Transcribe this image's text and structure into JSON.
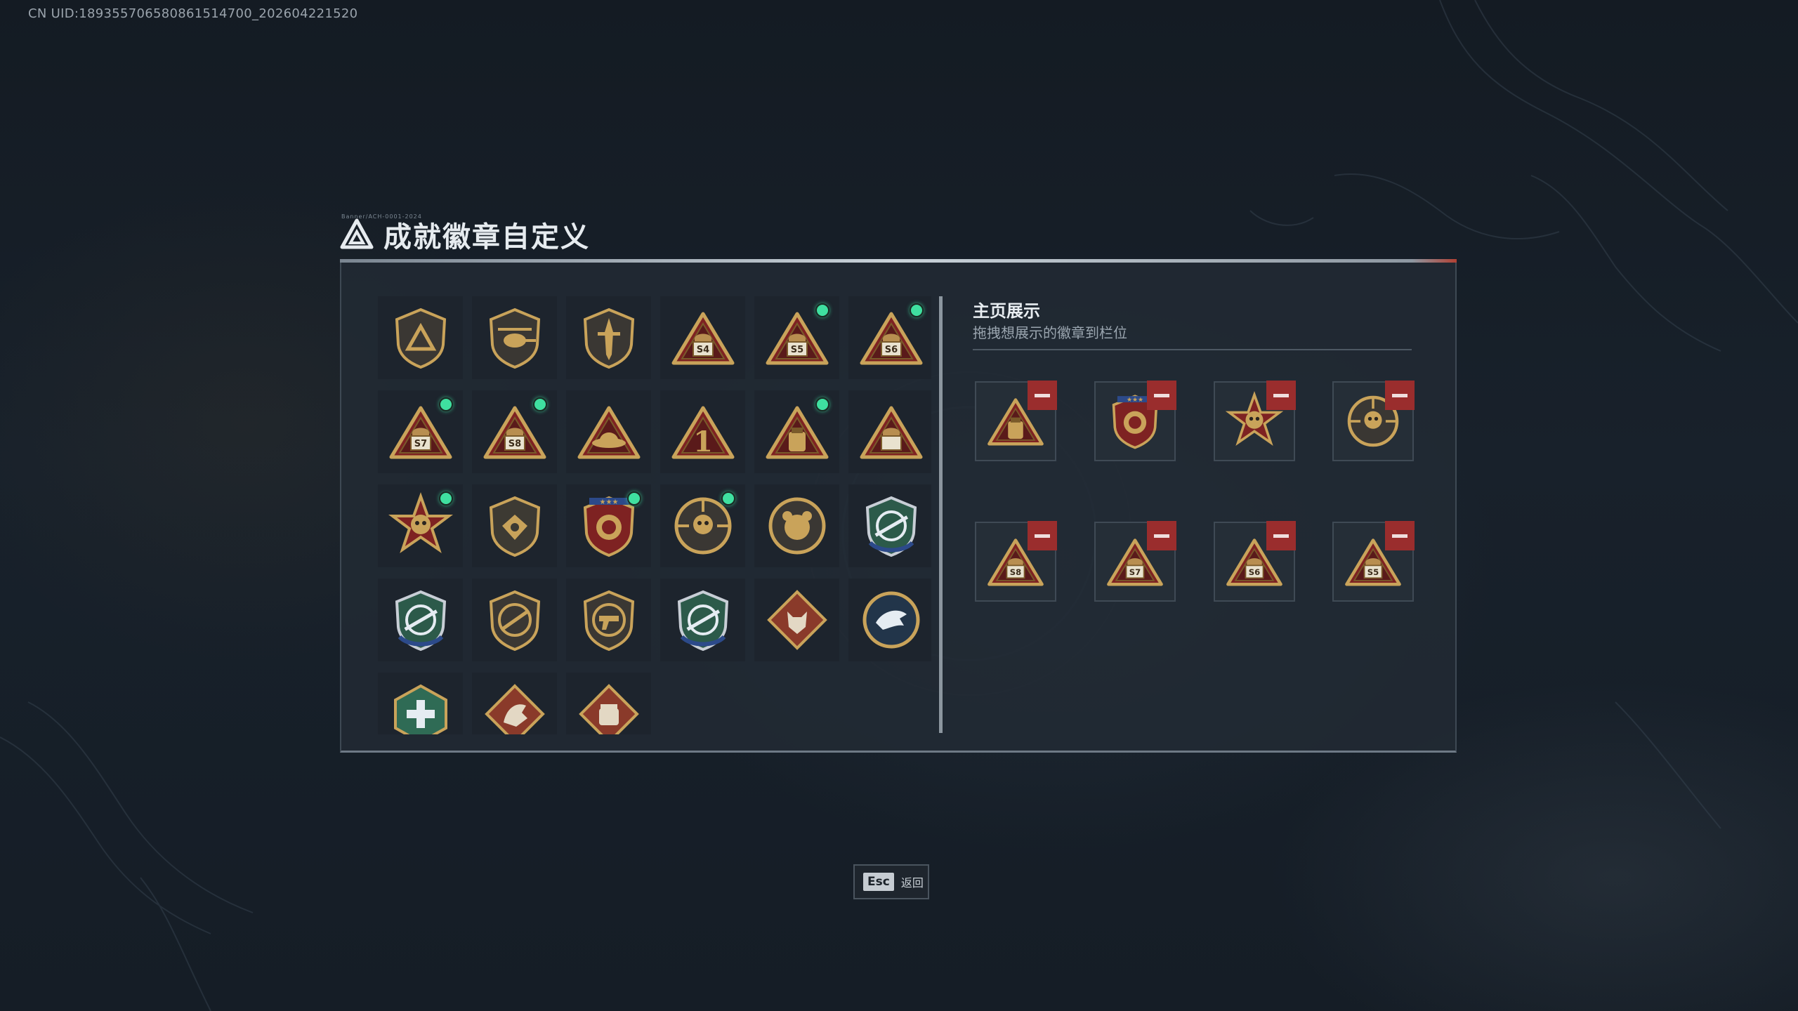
{
  "uid_text": "CN UID:189355706580861514700_202604221520",
  "header": {
    "title": "成就徽章自定义",
    "tiny_text": "Banner/ACH-0001-2024"
  },
  "showcase": {
    "title": "主页展示",
    "subtitle": "拖拽想展示的徽章到栏位"
  },
  "footer": {
    "esc_key": "Esc",
    "esc_label": "返回"
  },
  "colors": {
    "accent_new": "#3fe0a0",
    "remove_red": "#9a2d2d",
    "badge_gold": "#c9a35a",
    "panel_bg": "#222b35"
  },
  "badges": [
    {
      "id": "delta-shield-badge",
      "new": false
    },
    {
      "id": "helicopter-shield-badge",
      "new": false
    },
    {
      "id": "dagger-shield-badge",
      "new": false
    },
    {
      "id": "s4-pyramid-badge",
      "label": "S4",
      "new": false
    },
    {
      "id": "s5-pyramid-badge",
      "label": "S5",
      "new": true
    },
    {
      "id": "s6-pyramid-badge",
      "label": "S6",
      "new": true
    },
    {
      "id": "s7-pyramid-badge",
      "label": "S7",
      "new": true
    },
    {
      "id": "s8-pyramid-badge",
      "label": "S8",
      "new": true
    },
    {
      "id": "hat-pyramid-badge",
      "new": false
    },
    {
      "id": "rank-one-pyramid-badge",
      "label": "1",
      "new": false
    },
    {
      "id": "backpack-pyramid-badge",
      "new": true
    },
    {
      "id": "soldier-pyramid-badge",
      "new": false
    },
    {
      "id": "star-skull-medal-badge",
      "new": true
    },
    {
      "id": "wings-shield-badge",
      "new": false
    },
    {
      "id": "red-crest-medal-badge",
      "new": true
    },
    {
      "id": "skull-crosshair-badge",
      "new": true
    },
    {
      "id": "bear-round-badge",
      "new": false
    },
    {
      "id": "blue-sniper-shield-badge",
      "new": false
    },
    {
      "id": "blue-rifle-shield-badge",
      "new": false
    },
    {
      "id": "rifle-shield-badge",
      "new": false
    },
    {
      "id": "pistol-shield-badge",
      "new": false
    },
    {
      "id": "blue-crosshair-shield-badge",
      "new": false
    },
    {
      "id": "wolf-diamond-badge",
      "new": false
    },
    {
      "id": "eagle-round-badge",
      "new": false
    },
    {
      "id": "medic-hex-badge",
      "new": false
    },
    {
      "id": "dragon-diamond-badge",
      "new": false
    },
    {
      "id": "fist-diamond-badge",
      "new": false
    }
  ],
  "display_slots": [
    {
      "id": "backpack-pyramid-badge"
    },
    {
      "id": "red-crest-medal-badge"
    },
    {
      "id": "star-skull-medal-badge"
    },
    {
      "id": "skull-crosshair-badge"
    },
    {
      "id": "s8-pyramid-badge",
      "label": "S8"
    },
    {
      "id": "s7-pyramid-badge",
      "label": "S7"
    },
    {
      "id": "s6-pyramid-badge",
      "label": "S6"
    },
    {
      "id": "s5-pyramid-badge",
      "label": "S5"
    }
  ]
}
